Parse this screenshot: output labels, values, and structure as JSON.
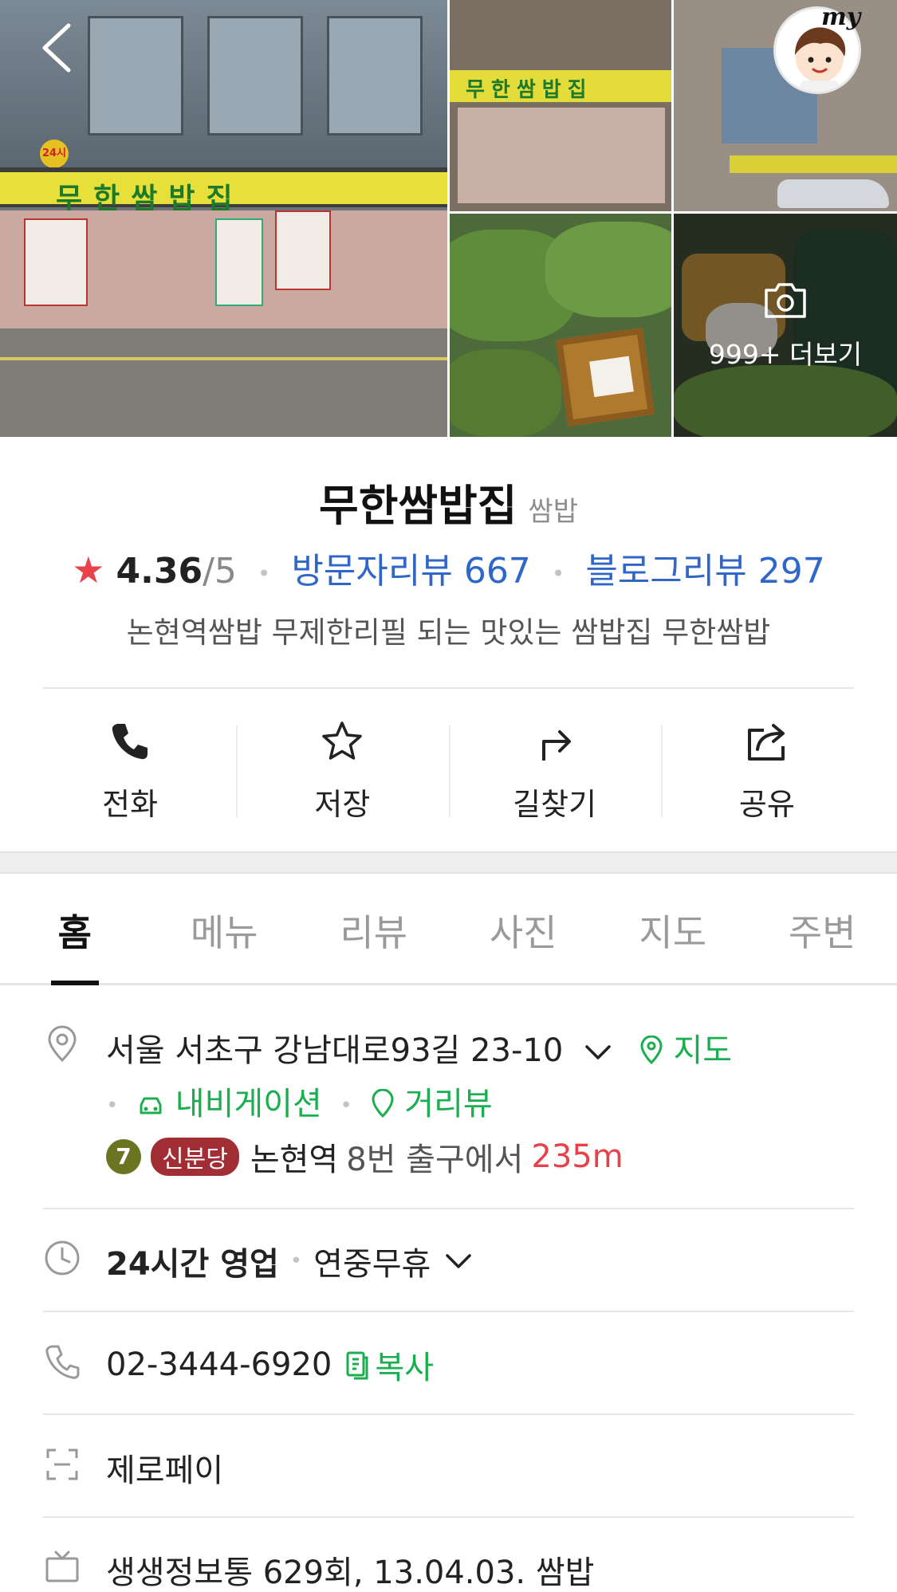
{
  "header": {
    "my_label": "my",
    "more_photos_label": "999+ 더보기"
  },
  "place": {
    "name": "무한쌈밥집",
    "category": "쌈밥",
    "rating": "4.36",
    "rating_max": "/5",
    "visitor_reviews": "방문자리뷰 667",
    "blog_reviews": "블로그리뷰 297",
    "description": "논현역쌈밥 무제한리필 되는 맛있는 쌈밥집 무한쌈밥"
  },
  "actions": [
    {
      "label": "전화",
      "icon": "phone-icon"
    },
    {
      "label": "저장",
      "icon": "star-outline-icon"
    },
    {
      "label": "길찾기",
      "icon": "directions-icon"
    },
    {
      "label": "공유",
      "icon": "share-icon"
    }
  ],
  "tabs": [
    {
      "label": "홈",
      "active": true
    },
    {
      "label": "메뉴"
    },
    {
      "label": "리뷰"
    },
    {
      "label": "사진"
    },
    {
      "label": "지도"
    },
    {
      "label": "주변"
    }
  ],
  "info": {
    "address": "서울 서초구 강남대로93길 23-10",
    "map_link": "지도",
    "navigation_link": "내비게이션",
    "street_view_link": "거리뷰",
    "subway_line_number": "7",
    "subway_line_name": "신분당",
    "subway_station": "논현역",
    "subway_exit": "8번 출구에서",
    "subway_distance": "235m",
    "hours_main": "24시간 영업",
    "hours_sub": "연중무휴",
    "phone": "02-3444-6920",
    "copy_label": "복사",
    "payment": "제로페이",
    "tv": "생생정보통 629회, 13.04.03. 쌈밥"
  },
  "photo_signs": {
    "main_sign": "무한쌈밥집",
    "badge": "24시"
  },
  "colors": {
    "accent_green": "#1aae4f",
    "link_blue": "#2f66c7",
    "rating_star": "#e8414a",
    "subway_line_7": "#6b7420",
    "subway_shinbundang": "#a12e35"
  }
}
